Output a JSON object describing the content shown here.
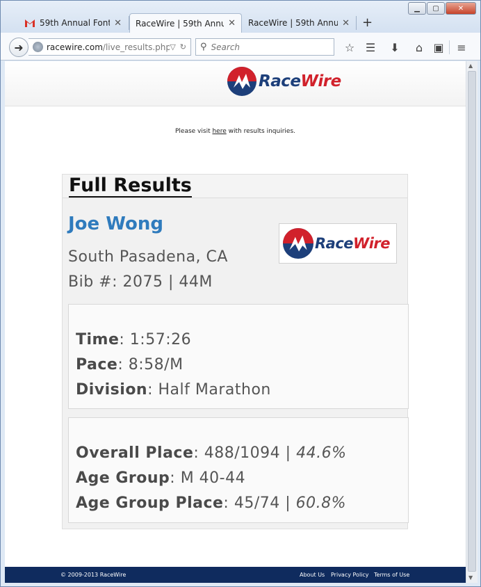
{
  "browser": {
    "tabs": [
      {
        "label": "59th Annual Font...",
        "icon": "gmail-icon",
        "active": false
      },
      {
        "label": "RaceWire | 59th Annu...",
        "icon": "none",
        "active": true
      },
      {
        "label": "RaceWire | 59th Annu...",
        "icon": "none",
        "active": false
      }
    ],
    "new_tab": "+",
    "url_host": "racewire.com",
    "url_path": "/live_results.php?f",
    "search_placeholder": "Search"
  },
  "site": {
    "logo_text_a": "Race",
    "logo_text_b": "Wire",
    "notice_prefix": "Please visit ",
    "notice_link": "here",
    "notice_suffix": " with results inquiries."
  },
  "results": {
    "section_title": "Full Results",
    "name": "Joe Wong",
    "city": "South Pasadena, CA",
    "bib_line": "Bib #: 2075 | 44M",
    "time_label": "Time",
    "time_value": ": 1:57:26",
    "pace_label": "Pace",
    "pace_value": ": 8:58/M",
    "division_label": "Division",
    "division_value": ": Half Marathon",
    "overall_label": "Overall Place",
    "overall_value": ": 488/1094 | ",
    "overall_pct": "44.6%",
    "agegroup_label": "Age Group",
    "agegroup_value": ": M 40-44",
    "agplace_label": "Age Group Place",
    "agplace_value": ": 45/74 | ",
    "agplace_pct": "60.8%"
  },
  "footer": {
    "copyright": "© 2009-2013 RaceWire",
    "links": [
      "About Us",
      "Privacy Policy",
      "Terms of Use"
    ]
  },
  "colors": {
    "accent_blue": "#2f7bbd",
    "brand_red": "#d1212b",
    "brand_navy": "#1d3f7a",
    "footer_bg": "#0f2b5e"
  }
}
